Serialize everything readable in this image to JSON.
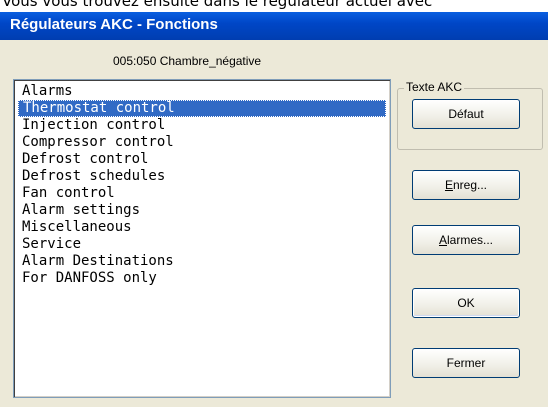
{
  "caption": "Vous vous trouvez ensuite dans le régulateur actuel avec",
  "window": {
    "title": "Régulateurs AKC - Fonctions",
    "path": "005:050  Chambre_négative"
  },
  "list": {
    "items": [
      "Alarms",
      "Thermostat control",
      "Injection control",
      "Compressor control",
      "Defrost control",
      "Defrost schedules",
      "Fan control",
      "Alarm settings",
      "Miscellaneous",
      "Service",
      "Alarm Destinations",
      "For DANFOSS only"
    ],
    "selected_index": 1
  },
  "group": {
    "label": "Texte AKC"
  },
  "buttons": {
    "default": "Défaut",
    "save_prefix": "E",
    "save_rest": "nreg...",
    "alarms_prefix": "A",
    "alarms_rest": "larmes...",
    "ok": "OK",
    "close": "Fermer"
  },
  "colors": {
    "titlebar": "#0046c7",
    "selection": "#316ac5",
    "dialog": "#ece9d8"
  }
}
